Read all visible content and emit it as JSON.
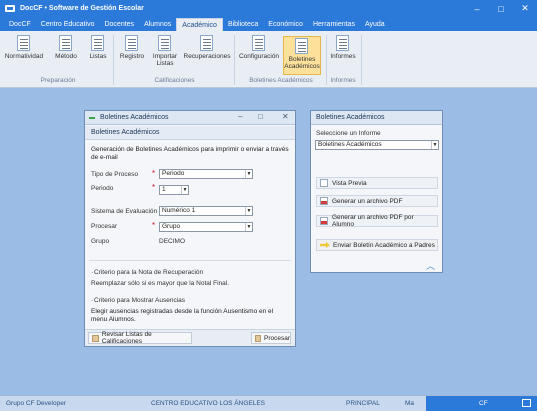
{
  "window": {
    "title": "DocCF • Software de Gestión Escolar"
  },
  "menu": [
    "DocCF",
    "Centro Educativo",
    "Docentes",
    "Alumnos",
    "Académico",
    "Biblioteca",
    "Económico",
    "Herramientas",
    "Ayuda"
  ],
  "menu_active": "Académico",
  "ribbon": {
    "preparacion": {
      "label": "Preparación",
      "buttons": [
        "Normatividad",
        "Método",
        "Listas"
      ]
    },
    "calificaciones": {
      "label": "Calificaciones",
      "buttons": [
        "Registro",
        "Importar Listas",
        "Recuperaciones"
      ]
    },
    "boletines": {
      "label": "Boletines Académicos",
      "buttons": [
        "Configuración",
        "Boletines Académicos"
      ]
    },
    "informes": {
      "label": "Informes",
      "buttons": [
        "Informes"
      ]
    },
    "selected": "Boletines Académicos"
  },
  "main_dialog": {
    "title": "Boletines Académicos",
    "header": "Boletines Académicos",
    "description": "Generación de Boletines Académicos para imprimir o enviar a través de e-mail",
    "fields": {
      "tipo_proceso": {
        "label": "Tipo de Proceso",
        "value": "Periodo"
      },
      "periodo": {
        "label": "Periodo",
        "value": "1"
      },
      "sistema_evaluacion": {
        "label": "Sistema de Evaluación",
        "value": "Numérico 1"
      },
      "procesar": {
        "label": "Procesar",
        "value": "Grupo"
      },
      "grupo": {
        "label": "Grupo",
        "value": "DECIMO"
      }
    },
    "criterio_recuperacion": {
      "title": "Criterio para la Nota de Recuperación",
      "text": "Reemplazar sólo si es mayor que la Notal Final."
    },
    "criterio_ausencias": {
      "title": "Criterio para Mostrar Ausencias",
      "text": "Elegir ausencias registradas desde la función Ausentismo en el menu Alumnos."
    },
    "revisar_button": "Revisar Listas de Calificaciones",
    "procesar_button": "Procesar"
  },
  "side_panel": {
    "title": "Boletines Académicos",
    "select_label": "Seleccione un Informe",
    "select_value": "Boletines Académicos",
    "buttons": [
      "Vista Previa",
      "Generar un archivo PDF",
      "Generar un archivo PDF por Alumno",
      "Enviar Boletín Académico a Padres"
    ]
  },
  "status": {
    "group": "Grupo CF Developer",
    "school": "CENTRO EDUCATIVO LOS ÁNGELES",
    "campus": "PRINCIPAL",
    "shift": "Ma",
    "cf": "CF"
  },
  "colors": {
    "titlebar": "#2b79d8",
    "desktop": "#9bbce4",
    "selected_ribbon": "#fde19a",
    "required": "#d0142c"
  }
}
